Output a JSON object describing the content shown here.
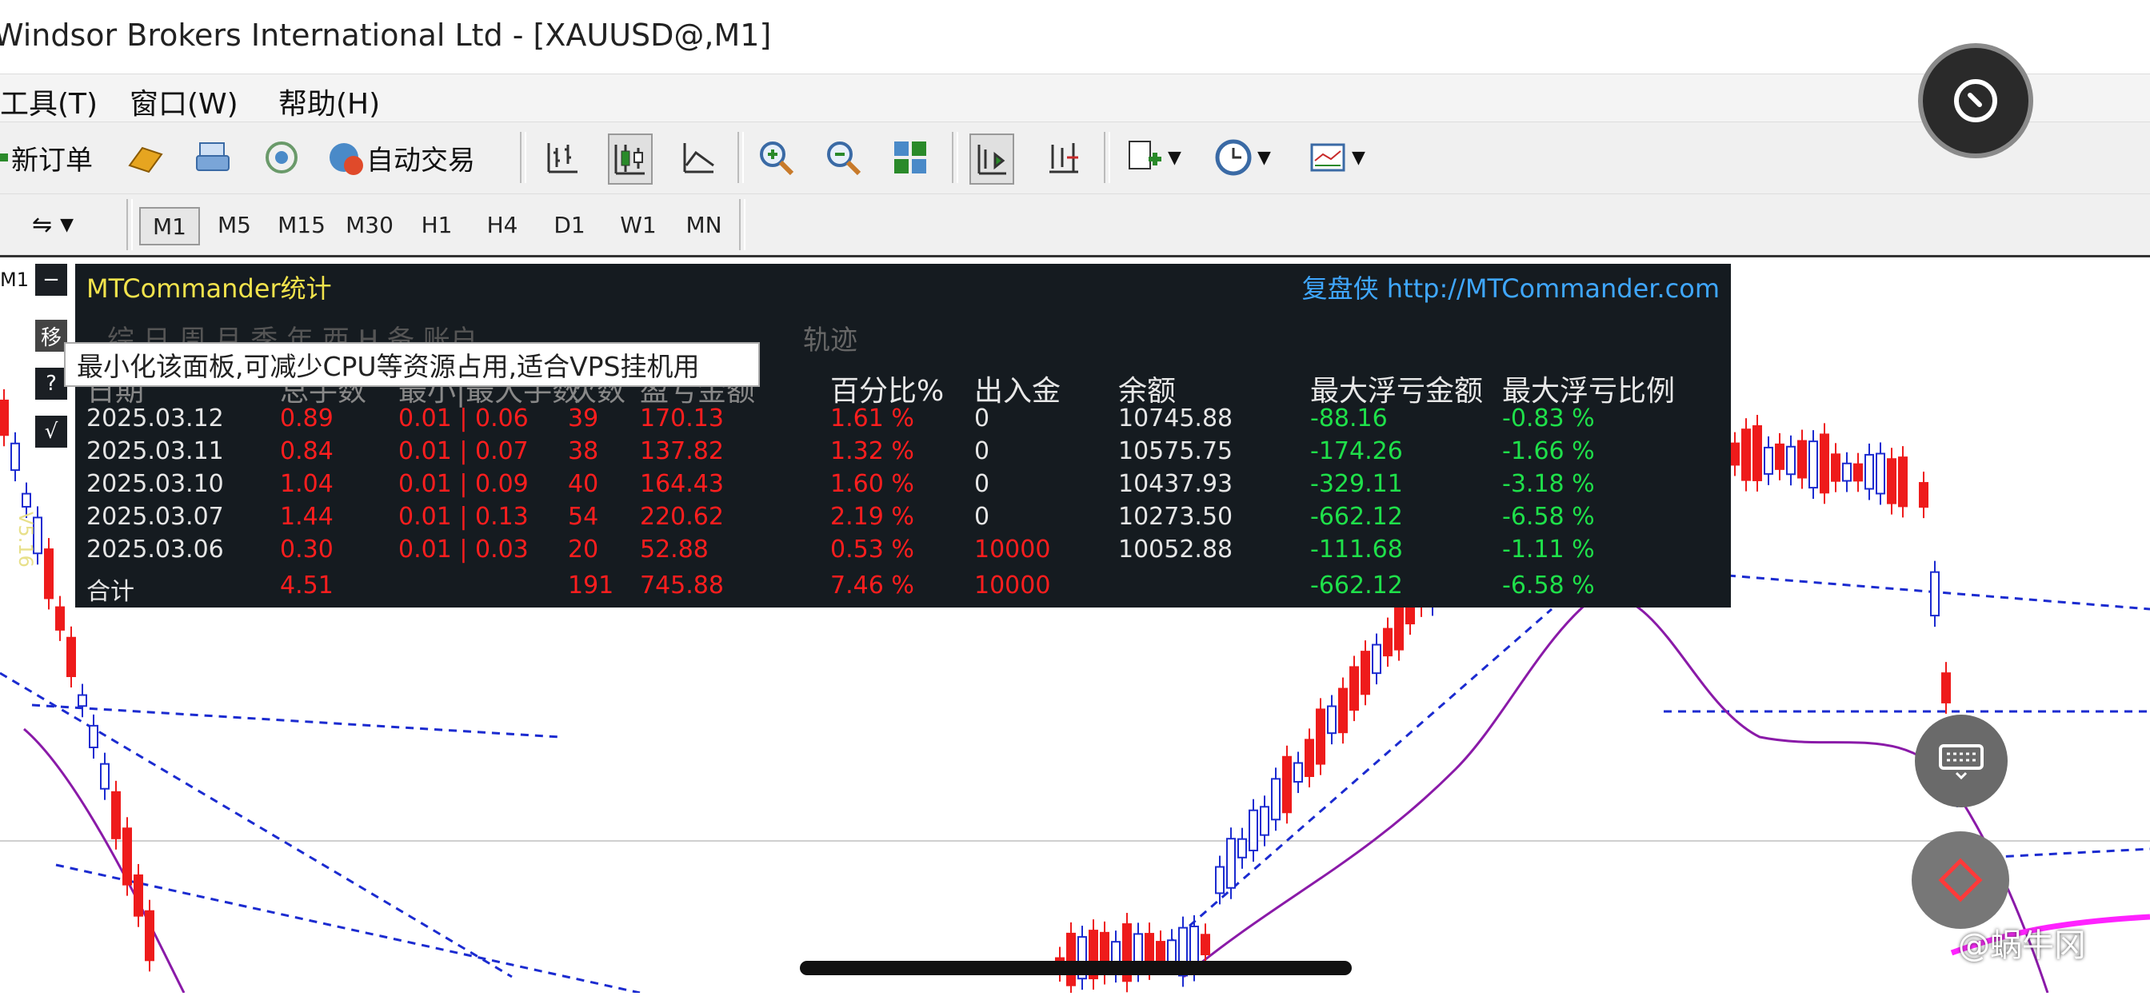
{
  "window": {
    "title": "Windsor Brokers International Ltd - [XAUUSD@,M1]"
  },
  "menu": {
    "items": [
      "工具(T)",
      "窗口(W)",
      "帮助(H)"
    ]
  },
  "toolbar": {
    "new_order": "新订单",
    "auto_trade": "自动交易"
  },
  "timeframes": {
    "items": [
      "M1",
      "M5",
      "M15",
      "M30",
      "H1",
      "H4",
      "D1",
      "W1",
      "MN"
    ],
    "active": "M1"
  },
  "chart_label": "M1",
  "side_buttons": {
    "minimize": "−",
    "move": "移",
    "help": "?",
    "check": "√"
  },
  "version_label": "V5.16",
  "panel": {
    "title": "MTCommander统计",
    "brand": "复盘侠",
    "url": "http://MTCommander.com",
    "tabs": "综 日 周 月 季 年 西 H 备 账户",
    "track_label": "轨迹",
    "tooltip": "最小化该面板,可减少CPU等资源占用,适合VPS挂机用",
    "headers": [
      "日期",
      "总手数",
      "最小|最大手数",
      "次数",
      "盈亏金额",
      "百分比%",
      "出入金",
      "余额",
      "最大浮亏金额",
      "最大浮亏比例"
    ],
    "rows": [
      [
        "2025.03.12",
        "0.89",
        "0.01 | 0.06",
        "39",
        "170.13",
        "1.61 %",
        "0",
        "10745.88",
        "-88.16",
        "-0.83 %"
      ],
      [
        "2025.03.11",
        "0.84",
        "0.01 | 0.07",
        "38",
        "137.82",
        "1.32 %",
        "0",
        "10575.75",
        "-174.26",
        "-1.66 %"
      ],
      [
        "2025.03.10",
        "1.04",
        "0.01 | 0.09",
        "40",
        "164.43",
        "1.60 %",
        "0",
        "10437.93",
        "-329.11",
        "-3.18 %"
      ],
      [
        "2025.03.07",
        "1.44",
        "0.01 | 0.13",
        "54",
        "220.62",
        "2.19 %",
        "0",
        "10273.50",
        "-662.12",
        "-6.58 %"
      ],
      [
        "2025.03.06",
        "0.30",
        "0.01 | 0.03",
        "20",
        "52.88",
        "0.53 %",
        "10000",
        "10052.88",
        "-111.68",
        "-1.11 %"
      ]
    ],
    "total": [
      "合计",
      "4.51",
      "",
      "191",
      "745.88",
      "7.46 %",
      "10000",
      "",
      "-662.12",
      "-6.58 %"
    ]
  },
  "watermark": "@蜗牛冈",
  "colors": {
    "panel_bg": "#151b20",
    "loss": "#ff1e1e",
    "gain": "#1fe04a",
    "title": "#f2e34c",
    "link": "#3fa7ff"
  }
}
